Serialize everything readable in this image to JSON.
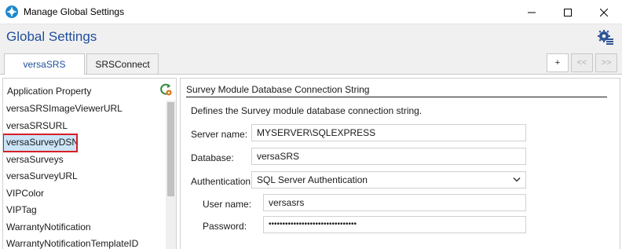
{
  "window": {
    "title": "Manage Global Settings"
  },
  "header": {
    "title": "Global Settings"
  },
  "tabs": [
    {
      "label": "versaSRS",
      "active": true
    },
    {
      "label": "SRSConnect",
      "active": false
    }
  ],
  "tab_actions": {
    "add": "+",
    "prev": "<<",
    "next": ">>"
  },
  "left_pane": {
    "header": "Application Property",
    "items": [
      "versaSRSImageViewerURL",
      "versaSRSURL",
      "versaSurveyDSN",
      "versaSurveys",
      "versaSurveyURL",
      "VIPColor",
      "VIPTag",
      "WarrantyNotification",
      "WarrantyNotificationTemplateID"
    ],
    "selected_index": 2
  },
  "right_pane": {
    "title": "Survey Module Database Connection String",
    "description": "Defines the Survey module database connection string.",
    "server_label": "Server name:",
    "server_value": "MYSERVER\\SQLEXPRESS",
    "database_label": "Database:",
    "database_value": "versaSRS",
    "auth_label": "Authentication:",
    "auth_value": "SQL Server Authentication",
    "username_label": "User name:",
    "username_value": "versasrs",
    "password_label": "Password:",
    "password_value": "••••••••••••••••••••••••••••••••"
  },
  "colors": {
    "accent": "#1f4e9c",
    "selection": "#cce4f7",
    "highlight_box": "#d61f26"
  }
}
